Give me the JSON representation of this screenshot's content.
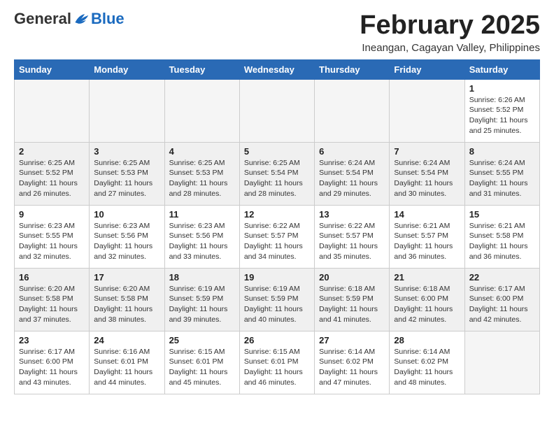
{
  "logo": {
    "general": "General",
    "blue": "Blue"
  },
  "title": "February 2025",
  "subtitle": "Ineangan, Cagayan Valley, Philippines",
  "days_of_week": [
    "Sunday",
    "Monday",
    "Tuesday",
    "Wednesday",
    "Thursday",
    "Friday",
    "Saturday"
  ],
  "weeks": [
    [
      {
        "day": "",
        "sunrise": "",
        "sunset": "",
        "daylight": "",
        "empty": true
      },
      {
        "day": "",
        "sunrise": "",
        "sunset": "",
        "daylight": "",
        "empty": true
      },
      {
        "day": "",
        "sunrise": "",
        "sunset": "",
        "daylight": "",
        "empty": true
      },
      {
        "day": "",
        "sunrise": "",
        "sunset": "",
        "daylight": "",
        "empty": true
      },
      {
        "day": "",
        "sunrise": "",
        "sunset": "",
        "daylight": "",
        "empty": true
      },
      {
        "day": "",
        "sunrise": "",
        "sunset": "",
        "daylight": "",
        "empty": true
      },
      {
        "day": "1",
        "sunrise": "Sunrise: 6:26 AM",
        "sunset": "Sunset: 5:52 PM",
        "daylight": "Daylight: 11 hours and 25 minutes.",
        "empty": false
      }
    ],
    [
      {
        "day": "2",
        "sunrise": "Sunrise: 6:25 AM",
        "sunset": "Sunset: 5:52 PM",
        "daylight": "Daylight: 11 hours and 26 minutes.",
        "empty": false
      },
      {
        "day": "3",
        "sunrise": "Sunrise: 6:25 AM",
        "sunset": "Sunset: 5:53 PM",
        "daylight": "Daylight: 11 hours and 27 minutes.",
        "empty": false
      },
      {
        "day": "4",
        "sunrise": "Sunrise: 6:25 AM",
        "sunset": "Sunset: 5:53 PM",
        "daylight": "Daylight: 11 hours and 28 minutes.",
        "empty": false
      },
      {
        "day": "5",
        "sunrise": "Sunrise: 6:25 AM",
        "sunset": "Sunset: 5:54 PM",
        "daylight": "Daylight: 11 hours and 28 minutes.",
        "empty": false
      },
      {
        "day": "6",
        "sunrise": "Sunrise: 6:24 AM",
        "sunset": "Sunset: 5:54 PM",
        "daylight": "Daylight: 11 hours and 29 minutes.",
        "empty": false
      },
      {
        "day": "7",
        "sunrise": "Sunrise: 6:24 AM",
        "sunset": "Sunset: 5:54 PM",
        "daylight": "Daylight: 11 hours and 30 minutes.",
        "empty": false
      },
      {
        "day": "8",
        "sunrise": "Sunrise: 6:24 AM",
        "sunset": "Sunset: 5:55 PM",
        "daylight": "Daylight: 11 hours and 31 minutes.",
        "empty": false
      }
    ],
    [
      {
        "day": "9",
        "sunrise": "Sunrise: 6:23 AM",
        "sunset": "Sunset: 5:55 PM",
        "daylight": "Daylight: 11 hours and 32 minutes.",
        "empty": false
      },
      {
        "day": "10",
        "sunrise": "Sunrise: 6:23 AM",
        "sunset": "Sunset: 5:56 PM",
        "daylight": "Daylight: 11 hours and 32 minutes.",
        "empty": false
      },
      {
        "day": "11",
        "sunrise": "Sunrise: 6:23 AM",
        "sunset": "Sunset: 5:56 PM",
        "daylight": "Daylight: 11 hours and 33 minutes.",
        "empty": false
      },
      {
        "day": "12",
        "sunrise": "Sunrise: 6:22 AM",
        "sunset": "Sunset: 5:57 PM",
        "daylight": "Daylight: 11 hours and 34 minutes.",
        "empty": false
      },
      {
        "day": "13",
        "sunrise": "Sunrise: 6:22 AM",
        "sunset": "Sunset: 5:57 PM",
        "daylight": "Daylight: 11 hours and 35 minutes.",
        "empty": false
      },
      {
        "day": "14",
        "sunrise": "Sunrise: 6:21 AM",
        "sunset": "Sunset: 5:57 PM",
        "daylight": "Daylight: 11 hours and 36 minutes.",
        "empty": false
      },
      {
        "day": "15",
        "sunrise": "Sunrise: 6:21 AM",
        "sunset": "Sunset: 5:58 PM",
        "daylight": "Daylight: 11 hours and 36 minutes.",
        "empty": false
      }
    ],
    [
      {
        "day": "16",
        "sunrise": "Sunrise: 6:20 AM",
        "sunset": "Sunset: 5:58 PM",
        "daylight": "Daylight: 11 hours and 37 minutes.",
        "empty": false
      },
      {
        "day": "17",
        "sunrise": "Sunrise: 6:20 AM",
        "sunset": "Sunset: 5:58 PM",
        "daylight": "Daylight: 11 hours and 38 minutes.",
        "empty": false
      },
      {
        "day": "18",
        "sunrise": "Sunrise: 6:19 AM",
        "sunset": "Sunset: 5:59 PM",
        "daylight": "Daylight: 11 hours and 39 minutes.",
        "empty": false
      },
      {
        "day": "19",
        "sunrise": "Sunrise: 6:19 AM",
        "sunset": "Sunset: 5:59 PM",
        "daylight": "Daylight: 11 hours and 40 minutes.",
        "empty": false
      },
      {
        "day": "20",
        "sunrise": "Sunrise: 6:18 AM",
        "sunset": "Sunset: 5:59 PM",
        "daylight": "Daylight: 11 hours and 41 minutes.",
        "empty": false
      },
      {
        "day": "21",
        "sunrise": "Sunrise: 6:18 AM",
        "sunset": "Sunset: 6:00 PM",
        "daylight": "Daylight: 11 hours and 42 minutes.",
        "empty": false
      },
      {
        "day": "22",
        "sunrise": "Sunrise: 6:17 AM",
        "sunset": "Sunset: 6:00 PM",
        "daylight": "Daylight: 11 hours and 42 minutes.",
        "empty": false
      }
    ],
    [
      {
        "day": "23",
        "sunrise": "Sunrise: 6:17 AM",
        "sunset": "Sunset: 6:00 PM",
        "daylight": "Daylight: 11 hours and 43 minutes.",
        "empty": false
      },
      {
        "day": "24",
        "sunrise": "Sunrise: 6:16 AM",
        "sunset": "Sunset: 6:01 PM",
        "daylight": "Daylight: 11 hours and 44 minutes.",
        "empty": false
      },
      {
        "day": "25",
        "sunrise": "Sunrise: 6:15 AM",
        "sunset": "Sunset: 6:01 PM",
        "daylight": "Daylight: 11 hours and 45 minutes.",
        "empty": false
      },
      {
        "day": "26",
        "sunrise": "Sunrise: 6:15 AM",
        "sunset": "Sunset: 6:01 PM",
        "daylight": "Daylight: 11 hours and 46 minutes.",
        "empty": false
      },
      {
        "day": "27",
        "sunrise": "Sunrise: 6:14 AM",
        "sunset": "Sunset: 6:02 PM",
        "daylight": "Daylight: 11 hours and 47 minutes.",
        "empty": false
      },
      {
        "day": "28",
        "sunrise": "Sunrise: 6:14 AM",
        "sunset": "Sunset: 6:02 PM",
        "daylight": "Daylight: 11 hours and 48 minutes.",
        "empty": false
      },
      {
        "day": "",
        "sunrise": "",
        "sunset": "",
        "daylight": "",
        "empty": true
      }
    ]
  ]
}
